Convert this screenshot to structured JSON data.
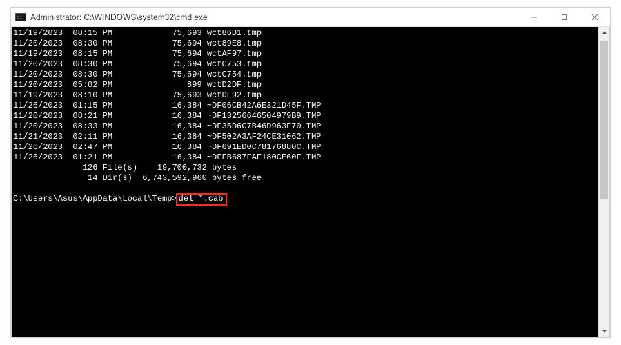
{
  "window": {
    "title": "Administrator: C:\\WINDOWS\\system32\\cmd.exe"
  },
  "listing": [
    {
      "date": "11/19/2023",
      "time": "08:15 PM",
      "size": "75,693",
      "name": "wct86D1.tmp"
    },
    {
      "date": "11/20/2023",
      "time": "08:30 PM",
      "size": "75,694",
      "name": "wct89E8.tmp"
    },
    {
      "date": "11/19/2023",
      "time": "08:15 PM",
      "size": "75,694",
      "name": "wctAF97.tmp"
    },
    {
      "date": "11/20/2023",
      "time": "08:30 PM",
      "size": "75,694",
      "name": "wctC753.tmp"
    },
    {
      "date": "11/20/2023",
      "time": "08:30 PM",
      "size": "75,694",
      "name": "wctC754.tmp"
    },
    {
      "date": "11/20/2023",
      "time": "05:02 PM",
      "size": "899",
      "name": "wctD2DF.tmp"
    },
    {
      "date": "11/19/2023",
      "time": "08:10 PM",
      "size": "75,693",
      "name": "wctDF92.tmp"
    },
    {
      "date": "11/26/2023",
      "time": "01:15 PM",
      "size": "16,384",
      "name": "~DF06CB42A6E321D45F.TMP"
    },
    {
      "date": "11/20/2023",
      "time": "08:21 PM",
      "size": "16,384",
      "name": "~DF13256646504979B9.TMP"
    },
    {
      "date": "11/20/2023",
      "time": "08:33 PM",
      "size": "16,384",
      "name": "~DF35D6C7B46D963F70.TMP"
    },
    {
      "date": "11/21/2023",
      "time": "02:11 PM",
      "size": "16,384",
      "name": "~DF502A3AF24CE31062.TMP"
    },
    {
      "date": "11/26/2023",
      "time": "02:47 PM",
      "size": "16,384",
      "name": "~DF691ED0C78176880C.TMP"
    },
    {
      "date": "11/26/2023",
      "time": "01:21 PM",
      "size": "16,384",
      "name": "~DFFB687FAF180CE60F.TMP"
    }
  ],
  "summary": {
    "files_count": "126",
    "files_label": "File(s)",
    "files_bytes": "19,700,732",
    "files_bytes_label": "bytes",
    "dirs_count": "14",
    "dirs_label": "Dir(s)",
    "dirs_bytes": "6,743,592,960",
    "dirs_bytes_label": "bytes free"
  },
  "prompt": {
    "path": "C:\\Users\\Asus\\AppData\\Local\\Temp>",
    "command": "del *.cab"
  },
  "highlight_color": "#ff2a1a",
  "scrollbar": {
    "thumb_top_pct": 1,
    "thumb_height_pct": 55
  }
}
